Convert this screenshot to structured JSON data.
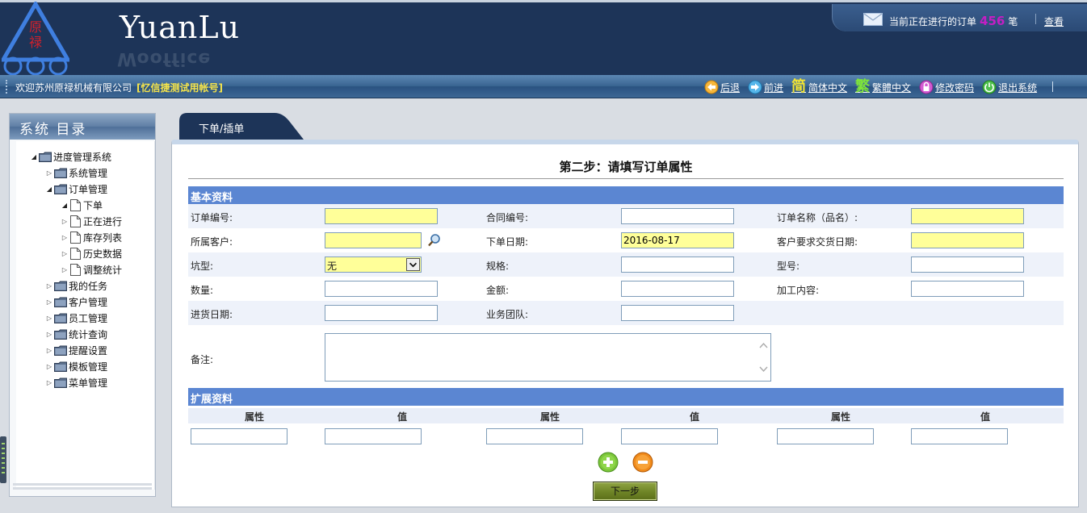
{
  "header": {
    "logo_chars": [
      "原",
      "禄"
    ],
    "brand": "YuanLu",
    "brand_reflection": "Wooffice",
    "notice_prefix": "当前正在进行的订单",
    "notice_count": "456",
    "notice_suffix": "笔",
    "notice_view": "查看"
  },
  "navbar": {
    "welcome": "欢迎苏州原禄机械有限公司",
    "account": "[忆信捷测试用帐号]",
    "links": [
      {
        "label": "后退",
        "icon": "back-arrow-icon"
      },
      {
        "label": "前进",
        "icon": "forward-arrow-icon"
      },
      {
        "label": "简体中文",
        "glyph": "简",
        "icon": "simplified-chinese-icon"
      },
      {
        "label": "繁體中文",
        "glyph": "繁",
        "icon": "traditional-chinese-icon"
      },
      {
        "label": "修改密码",
        "icon": "lock-icon"
      },
      {
        "label": "退出系统",
        "icon": "exit-icon"
      }
    ]
  },
  "sidebar": {
    "title": "系统 目录",
    "tree": [
      {
        "label": "进度管理系统",
        "level": 0,
        "type": "folder",
        "expanded": true
      },
      {
        "label": "系统管理",
        "level": 1,
        "type": "folder",
        "expanded": false
      },
      {
        "label": "订单管理",
        "level": 1,
        "type": "folder",
        "expanded": true
      },
      {
        "label": "下单",
        "level": 2,
        "type": "file",
        "expanded": true
      },
      {
        "label": "正在进行",
        "level": 2,
        "type": "file",
        "expanded": false
      },
      {
        "label": "库存列表",
        "level": 2,
        "type": "file",
        "expanded": false
      },
      {
        "label": "历史数据",
        "level": 2,
        "type": "file",
        "expanded": false
      },
      {
        "label": "调整统计",
        "level": 2,
        "type": "file",
        "expanded": false
      },
      {
        "label": "我的任务",
        "level": 1,
        "type": "folder",
        "expanded": false
      },
      {
        "label": "客户管理",
        "level": 1,
        "type": "folder",
        "expanded": false
      },
      {
        "label": "员工管理",
        "level": 1,
        "type": "folder",
        "expanded": false
      },
      {
        "label": "统计查询",
        "level": 1,
        "type": "folder",
        "expanded": false
      },
      {
        "label": "提醒设置",
        "level": 1,
        "type": "folder",
        "expanded": false
      },
      {
        "label": "模板管理",
        "level": 1,
        "type": "folder",
        "expanded": false
      },
      {
        "label": "菜单管理",
        "level": 1,
        "type": "folder",
        "expanded": false
      }
    ]
  },
  "tab": {
    "label": "下单/插单"
  },
  "form": {
    "step_title": "第二步：请填写订单属性",
    "basic_section": "基本资料",
    "labels": {
      "order_no": "订单编号:",
      "contract_no": "合同编号:",
      "order_name": "订单名称（品名）:",
      "customer": "所属客户:",
      "order_date": "下单日期:",
      "delivery_date": "客户要求交货日期:",
      "pit_type": "坑型:",
      "spec": "规格:",
      "model": "型号:",
      "quantity": "数量:",
      "amount": "金额:",
      "processing": "加工内容:",
      "purchase_date": "进货日期:",
      "sales_team": "业务团队:",
      "remark": "备注:"
    },
    "values": {
      "order_date": "2016-08-17",
      "pit_type": "无"
    },
    "ext_section": "扩展资料",
    "ext_headers": [
      "属性",
      "值",
      "属性",
      "值",
      "属性",
      "值"
    ],
    "next_button": "下一步"
  }
}
